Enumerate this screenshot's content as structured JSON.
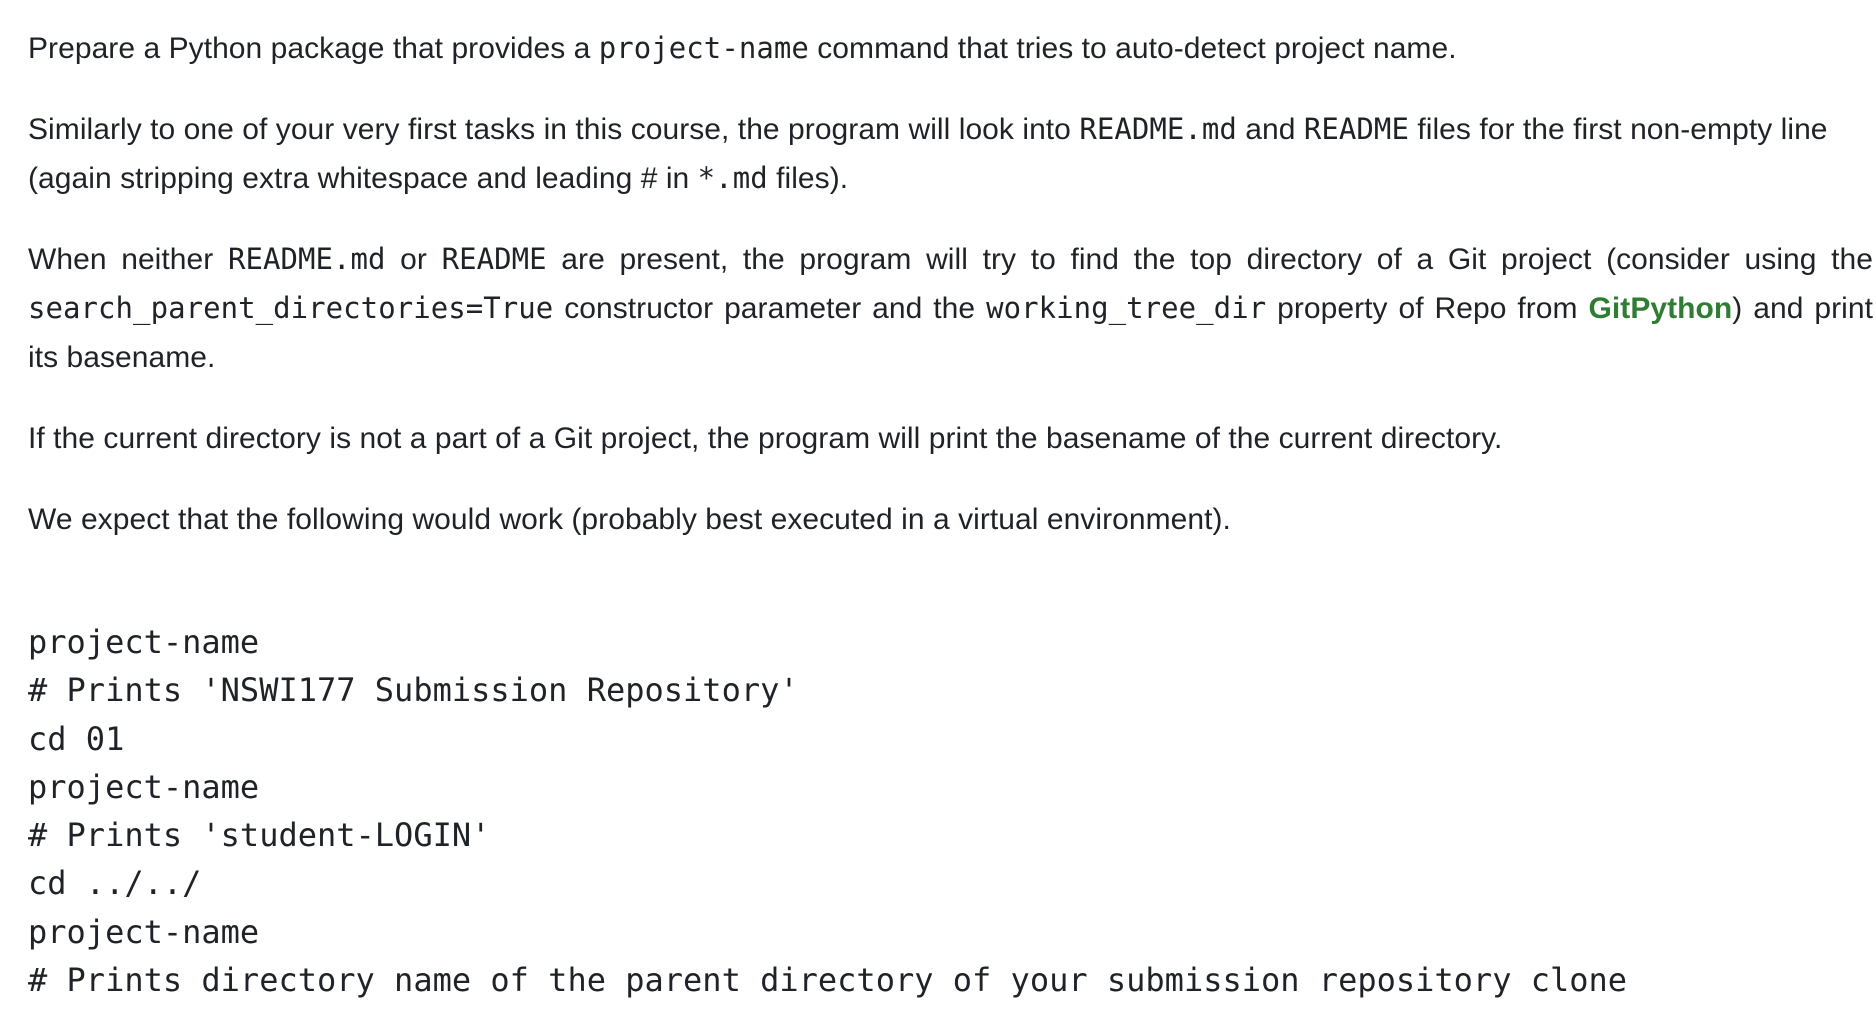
{
  "paragraphs": {
    "p1": {
      "t1": "Prepare a Python package that provides a ",
      "c1": "project-name",
      "t2": " command that tries to auto-detect project name."
    },
    "p2": {
      "t1": "Similarly to one of your very first tasks in this course, the program will look into ",
      "c1": "README.md",
      "t2": " and ",
      "c2": "README",
      "t3": " files for the first non-empty line (again stripping extra whitespace and leading ",
      "c3": "#",
      "t4": " in ",
      "c4": "*.md",
      "t5": " files)."
    },
    "p3": {
      "t1": "When neither ",
      "c1": "README.md",
      "t2": " or ",
      "c2": "README",
      "t3": " are present, the program will try to find the top directory of a Git project (consider using the ",
      "c3": "search_parent_directories=True",
      "t4": " constructor parameter and the ",
      "c4": "working_tree_dir",
      "t5": " property of ",
      "c5": "Repo",
      "t6": " from ",
      "link": "GitPython",
      "t7": ") and print its basename."
    },
    "p4": "If the current directory is not a part of a Git project, the program will print the basename of the current directory.",
    "p5": "We expect that the following would work (probably best executed in a virtual environment)."
  },
  "code_block": {
    "lines": [
      "project-name",
      "# Prints 'NSWI177 Submission Repository'",
      "cd 01",
      "project-name",
      "# Prints 'student-LOGIN'",
      "cd ../../",
      "project-name",
      "# Prints directory name of the parent directory of your submission repository clone"
    ]
  },
  "colors": {
    "text": "#1f2328",
    "link": "#2f7d32",
    "background": "#ffffff"
  }
}
